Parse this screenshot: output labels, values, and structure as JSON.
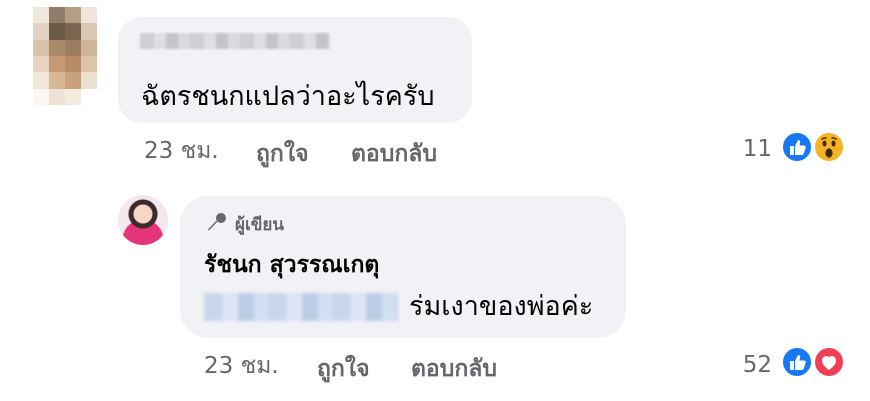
{
  "comment1": {
    "text": "ฉัตรชนกแปลว่าอะไรครับ",
    "time": "23 ชม.",
    "like_label": "ถูกใจ",
    "reply_label": "ตอบกลับ",
    "reaction_count": "11",
    "reactions": [
      "like-icon",
      "wow-icon"
    ]
  },
  "reply1": {
    "author_badge": "ผู้เขียน",
    "author_name": "รัชนก สุวรรณเกตุ",
    "text": "ร่มเงาของพ่อค่ะ",
    "time": "23 ชม.",
    "like_label": "ถูกใจ",
    "reply_label": "ตอบกลับ",
    "reaction_count": "52",
    "reactions": [
      "like-icon",
      "love-icon"
    ]
  },
  "colors": {
    "bubble": "#f0f2f5",
    "meta_text": "#65676b",
    "like_blue": "#1877f2",
    "love_red": "#f33e58",
    "wow_yellow": "#f7b125"
  }
}
